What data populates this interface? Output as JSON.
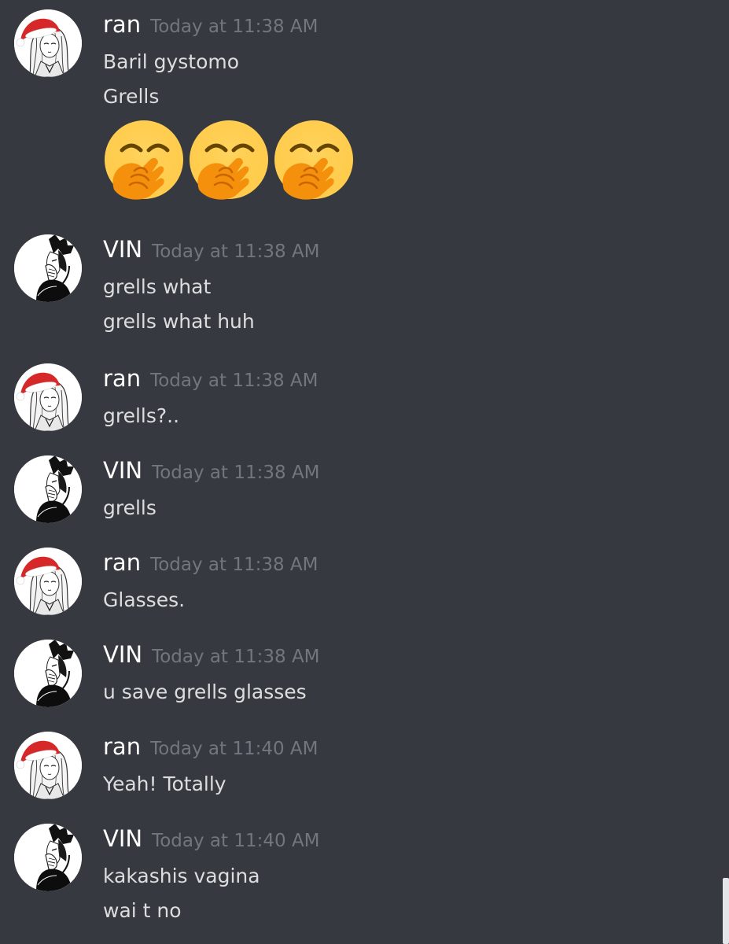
{
  "users": {
    "ran": {
      "name": "ran",
      "avatar": "ran-avatar-santa-hat"
    },
    "vin": {
      "name": "VIN",
      "avatar": "vin-avatar-manga"
    }
  },
  "messages": [
    {
      "user": "ran",
      "timestamp": "Today at 11:38 AM",
      "lines": [
        "Baril gystomo",
        "Grells"
      ],
      "emojis": [
        "hand-over-mouth-emoji",
        "hand-over-mouth-emoji",
        "hand-over-mouth-emoji"
      ]
    },
    {
      "user": "VIN",
      "timestamp": "Today at 11:38 AM",
      "lines": [
        "grells what",
        "grells what huh"
      ]
    },
    {
      "user": "ran",
      "timestamp": "Today at 11:38 AM",
      "lines": [
        "grells?.."
      ]
    },
    {
      "user": "VIN",
      "timestamp": "Today at 11:38 AM",
      "lines": [
        "grells"
      ]
    },
    {
      "user": "ran",
      "timestamp": "Today at 11:38 AM",
      "lines": [
        "Glasses."
      ]
    },
    {
      "user": "VIN",
      "timestamp": "Today at 11:38 AM",
      "lines": [
        "u save grells glasses"
      ]
    },
    {
      "user": "ran",
      "timestamp": "Today at 11:40 AM",
      "lines": [
        "Yeah! Totally"
      ]
    },
    {
      "user": "VIN",
      "timestamp": "Today at 11:40 AM",
      "lines": [
        "kakashis vagina",
        "wai t no"
      ]
    }
  ],
  "colors": {
    "background": "#36393f",
    "username": "#ffffff",
    "timestamp": "#72767d",
    "text": "#dcddde",
    "scrollbar": "#e3e5e8"
  }
}
